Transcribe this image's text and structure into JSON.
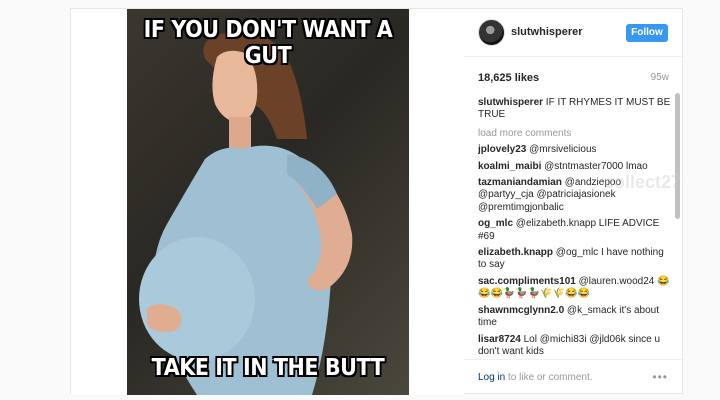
{
  "post": {
    "meme_top": "IF YOU DON'T WANT A GUT",
    "meme_bottom": "TAKE IT IN THE BUTT"
  },
  "header": {
    "username": "slutwhisperer",
    "follow_label": "Follow"
  },
  "stats": {
    "likes": "18,625 likes",
    "time_ago": "95w"
  },
  "caption": {
    "user": "slutwhisperer",
    "text": " IF IT RHYMES IT MUST BE TRUE"
  },
  "load_more": "load more comments",
  "comments": [
    {
      "user": "jplovely23",
      "text": " @mrsivelicious"
    },
    {
      "user": "koalmi_maibi",
      "text": " @stntmaster7000 lmao"
    },
    {
      "user": "tazmaniandamian",
      "text": " @andziepoo @partyy_cja @patriciajasionek @premtimgjonbalic"
    },
    {
      "user": "og_mlc",
      "text": " @elizabeth.knapp LIFE ADVICE #69"
    },
    {
      "user": "elizabeth.knapp",
      "text": " @og_mlc I have nothing to say"
    },
    {
      "user": "sac.compliments101",
      "text": " @lauren.wood24 😂😂😂🦆🦆🦆🌾🌾😂😂"
    },
    {
      "user": "shawnmcglynn2.0",
      "text": " @k_smack it's about time"
    },
    {
      "user": "lisar8724",
      "text": " Lol @michi83i @jld06k since u don't want kids"
    }
  ],
  "footer": {
    "login_link": "Log in",
    "login_text": " to like or comment.",
    "more_label": "•••"
  },
  "watermark": "collect27"
}
